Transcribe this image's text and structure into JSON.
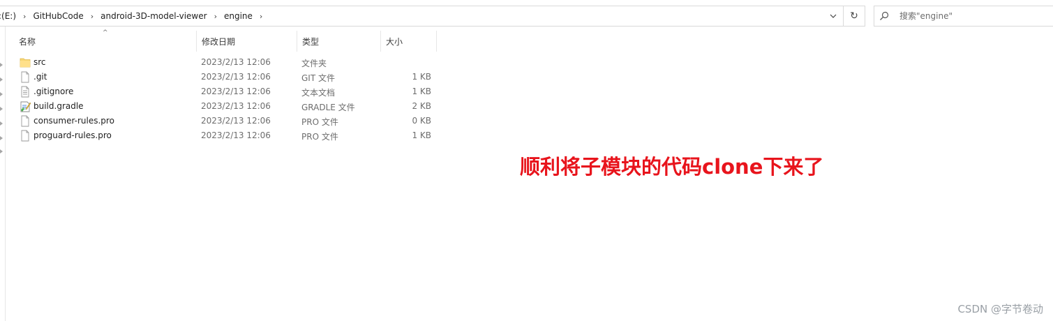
{
  "address_bar": {
    "breadcrumbs": [
      ":(E:)",
      "GitHubCode",
      "android-3D-model-viewer",
      "engine"
    ],
    "separator": "›",
    "dropdown_glyph": "⌄",
    "refresh_glyph": "↻"
  },
  "search": {
    "placeholder": "搜索\"engine\""
  },
  "columns": {
    "name": "名称",
    "date": "修改日期",
    "type": "类型",
    "size": "大小"
  },
  "sort_glyph": "^",
  "files": [
    {
      "name": "src",
      "date": "2023/2/13 12:06",
      "type": "文件夹",
      "size": "",
      "icon": "folder-icon"
    },
    {
      "name": ".git",
      "date": "2023/2/13 12:06",
      "type": "GIT 文件",
      "size": "1 KB",
      "icon": "file-icon"
    },
    {
      "name": ".gitignore",
      "date": "2023/2/13 12:06",
      "type": "文本文档",
      "size": "1 KB",
      "icon": "text-file-icon"
    },
    {
      "name": "build.gradle",
      "date": "2023/2/13 12:06",
      "type": "GRADLE 文件",
      "size": "2 KB",
      "icon": "gradle-file-icon"
    },
    {
      "name": "consumer-rules.pro",
      "date": "2023/2/13 12:06",
      "type": "PRO 文件",
      "size": "0 KB",
      "icon": "file-icon"
    },
    {
      "name": "proguard-rules.pro",
      "date": "2023/2/13 12:06",
      "type": "PRO 文件",
      "size": "1 KB",
      "icon": "file-icon"
    }
  ],
  "annotation": "顺利将子模块的代码clone下来了",
  "watermark": "CSDN @字节卷动",
  "colors": {
    "annotation": "#e8141c",
    "folder": "#f8d775",
    "watermark": "#9aa0a6"
  }
}
